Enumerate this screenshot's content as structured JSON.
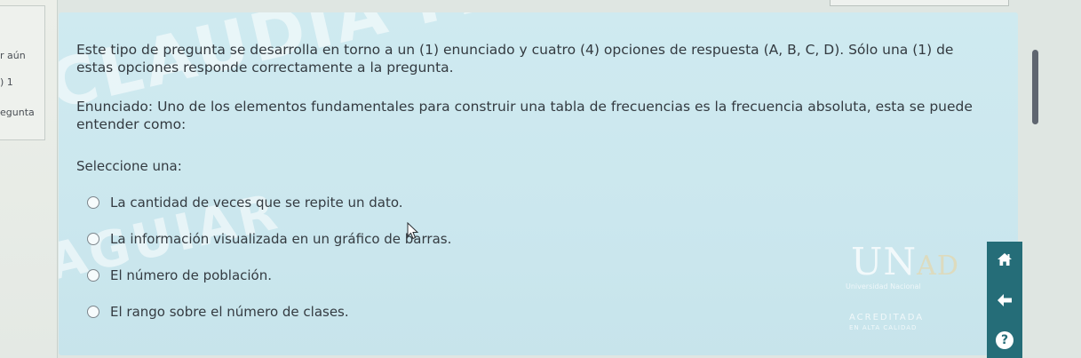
{
  "left_nav": {
    "labels": [
      "r aún",
      ") 1",
      "egunta"
    ]
  },
  "question": {
    "intro": "Este tipo de pregunta se desarrolla en torno a un (1) enunciado y cuatro (4) opciones de respuesta (A, B, C, D). Sólo una (1) de estas opciones responde correctamente a la pregunta.",
    "statement": "Enunciado: Uno de los elementos fundamentales para construir una tabla de frecuencias es la frecuencia absoluta, esta se puede entender como:",
    "select_label": "Seleccione una:",
    "options": [
      "La cantidad de veces que se repite un dato.",
      "La información visualizada en un gráfico de barras.",
      "El número de población.",
      "El rango sobre el número de clases."
    ]
  },
  "watermark": {
    "line1": "CLAUDIA PATRICIA QUIÑONEZ",
    "line2": "AGUIAR"
  },
  "logo": {
    "letters_main": "UN",
    "letters_accent": "AD",
    "subtitle": "Universidad Nacional",
    "accreditation": "ACREDITADA",
    "accreditation_sub": "EN ALTA CALIDAD"
  },
  "nav_buttons": {
    "help_label": "?"
  },
  "colors": {
    "panel": "#cce8ef",
    "nav": "#256d78",
    "text": "#333a40"
  }
}
